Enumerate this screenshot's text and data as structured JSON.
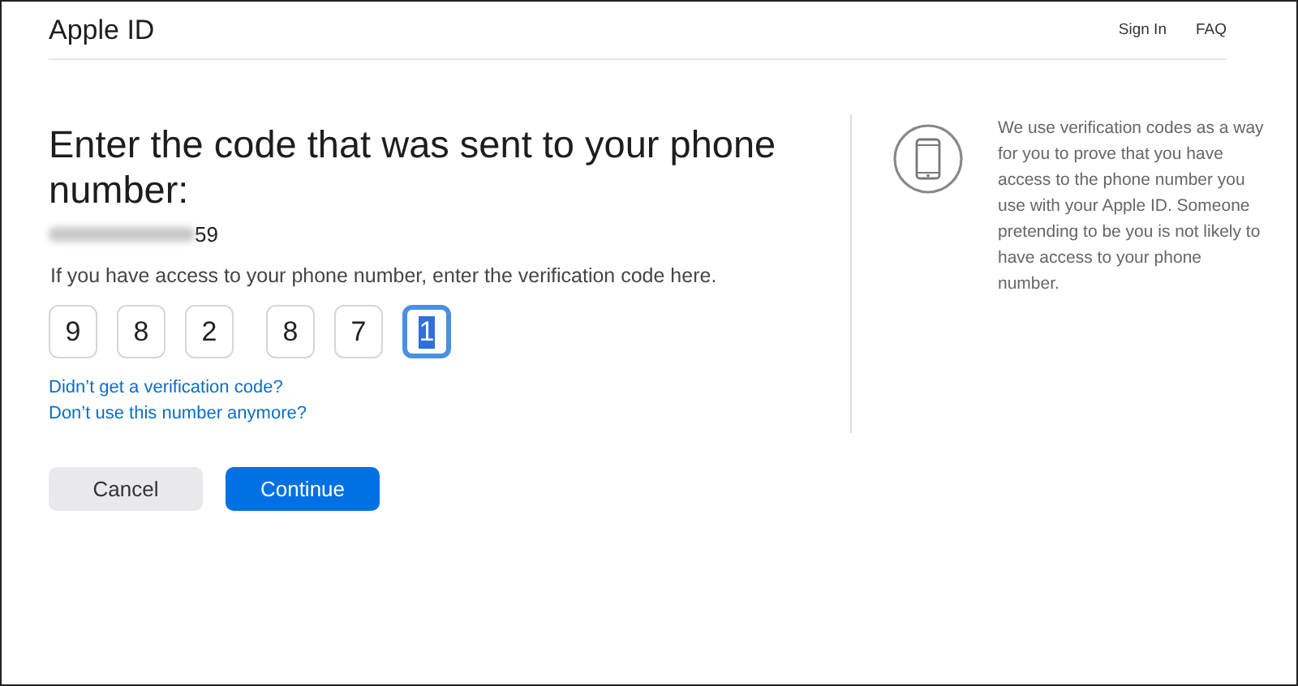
{
  "header": {
    "title": "Apple ID",
    "links": [
      "Sign In",
      "FAQ"
    ]
  },
  "heading": "Enter the code that was sent to your phone number:",
  "phone": {
    "redacted": true,
    "visible_digits": "59"
  },
  "instruction": "If you have access to your phone number, enter the verification code here.",
  "code_digits": [
    {
      "value": "9",
      "selected": false
    },
    {
      "value": "8",
      "selected": false
    },
    {
      "value": "2",
      "selected": false
    },
    {
      "value": "8",
      "selected": false
    },
    {
      "value": "7",
      "selected": false
    },
    {
      "value": "1",
      "selected": true
    }
  ],
  "help_links": [
    "Didn’t get a verification code?",
    "Don’t use this number anymore?"
  ],
  "buttons": [
    {
      "label": "Cancel",
      "kind": "secondary"
    },
    {
      "label": "Continue",
      "kind": "primary"
    }
  ],
  "info_text": "We use verification codes as a way for you to prove that you have access to the phone number you use with your Apple ID. Someone pretending to be you is not likely to have access to your phone number."
}
